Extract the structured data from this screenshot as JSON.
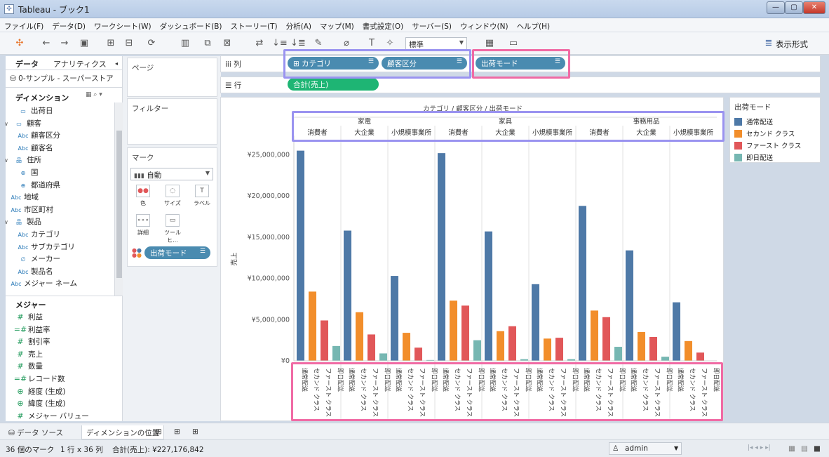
{
  "window": {
    "title": "Tableau - ブック1"
  },
  "menu": [
    "ファイル(F)",
    "データ(D)",
    "ワークシート(W)",
    "ダッシュボード(B)",
    "ストーリー(T)",
    "分析(A)",
    "マップ(M)",
    "書式設定(O)",
    "サーバー(S)",
    "ウィンドウ(N)",
    "ヘルプ(H)"
  ],
  "toolbar": {
    "fit_value": "標準",
    "show_me_label": "表示形式"
  },
  "left_pane": {
    "tab_data": "データ",
    "tab_analytics": "アナリティクス",
    "datasource": "0-サンプル - スーパーストア",
    "dimensions_header": "ディメンション",
    "dimensions": [
      {
        "icon": "calendar-icon",
        "glyph": "▭",
        "label": "出荷日",
        "indent": 2
      },
      {
        "icon": "folder-icon",
        "glyph": "▭",
        "label": "顧客",
        "indent": 1,
        "expand": "∨"
      },
      {
        "icon": "abc-icon",
        "glyph": "Abc",
        "label": "顧客区分",
        "indent": 2
      },
      {
        "icon": "abc-icon",
        "glyph": "Abc",
        "label": "顧客名",
        "indent": 2
      },
      {
        "icon": "hierarchy-icon",
        "glyph": "品",
        "label": "住所",
        "indent": 1,
        "expand": "∨"
      },
      {
        "icon": "globe-icon",
        "glyph": "⊕",
        "label": "国",
        "indent": 2
      },
      {
        "icon": "globe-icon",
        "glyph": "⊕",
        "label": "都道府県",
        "indent": 2
      },
      {
        "icon": "abc-icon",
        "glyph": "Abc",
        "label": "地域",
        "indent": 1
      },
      {
        "icon": "abc-icon",
        "glyph": "Abc",
        "label": "市区町村",
        "indent": 1
      },
      {
        "icon": "hierarchy-icon",
        "glyph": "品",
        "label": "製品",
        "indent": 1,
        "expand": "∨"
      },
      {
        "icon": "abc-icon",
        "glyph": "Abc",
        "label": "カテゴリ",
        "indent": 2
      },
      {
        "icon": "abc-icon",
        "glyph": "Abc",
        "label": "サブカテゴリ",
        "indent": 2
      },
      {
        "icon": "paperclip-icon",
        "glyph": "∅",
        "label": "メーカー",
        "indent": 2
      },
      {
        "icon": "abc-icon",
        "glyph": "Abc",
        "label": "製品名",
        "indent": 2
      },
      {
        "icon": "abc-icon",
        "glyph": "Abc",
        "label": "メジャー ネーム",
        "indent": 1
      }
    ],
    "measures_header": "メジャー",
    "measures": [
      {
        "glyph": "#",
        "label": "利益"
      },
      {
        "glyph": "=#",
        "label": "利益率"
      },
      {
        "glyph": "#",
        "label": "割引率"
      },
      {
        "glyph": "#",
        "label": "売上"
      },
      {
        "glyph": "#",
        "label": "数量"
      },
      {
        "glyph": "=#",
        "label": "レコード数"
      },
      {
        "glyph": "⊕",
        "label": "経度 (生成)"
      },
      {
        "glyph": "⊕",
        "label": "緯度 (生成)"
      },
      {
        "glyph": "#",
        "label": "メジャー バリュー"
      }
    ]
  },
  "cards": {
    "pages": "ページ",
    "filters": "フィルター",
    "marks": "マーク",
    "mark_type": "自動",
    "mark_buttons": [
      "色",
      "サイズ",
      "ラベル",
      "詳細",
      "ツールヒ..."
    ],
    "color_pill": "出荷モード"
  },
  "shelves": {
    "columns_label": "列",
    "rows_label": "行",
    "column_pills": [
      "カテゴリ",
      "顧客区分",
      "出荷モード"
    ],
    "row_pills": [
      "合計(売上)"
    ]
  },
  "chart_data": {
    "type": "bar",
    "title": "カテゴリ / 顧客区分 / 出荷モード",
    "ylabel": "売上",
    "ylim": [
      0,
      27000000
    ],
    "yticks": [
      "¥0",
      "¥5,000,000",
      "¥10,000,000",
      "¥15,000,000",
      "¥20,000,000",
      "¥25,000,000"
    ],
    "categories": [
      "家電",
      "家具",
      "事務用品"
    ],
    "segments": [
      "消費者",
      "大企業",
      "小規模事業所"
    ],
    "ship_modes": [
      "通常配送",
      "セカンド クラス",
      "ファースト クラス",
      "即日配送"
    ],
    "values": [
      [
        [
          25500000,
          8400000,
          4900000,
          1800000
        ],
        [
          15800000,
          5900000,
          3200000,
          900000
        ],
        [
          10300000,
          3400000,
          1600000,
          100000
        ]
      ],
      [
        [
          25200000,
          7300000,
          6700000,
          2500000
        ],
        [
          15700000,
          3600000,
          4200000,
          200000
        ],
        [
          9300000,
          2700000,
          2800000,
          200000
        ]
      ],
      [
        [
          18800000,
          6100000,
          5300000,
          1700000
        ],
        [
          13400000,
          3500000,
          2900000,
          500000
        ],
        [
          7100000,
          2400000,
          1000000,
          0
        ]
      ]
    ],
    "colors": [
      "#4e79a7",
      "#f28e2b",
      "#e15759",
      "#76b7b2"
    ]
  },
  "legend": {
    "title": "出荷モード"
  },
  "bottom_tabs": {
    "datasource_tab": "データ ソース",
    "sheet_tab": "ディメンションの位置"
  },
  "status": {
    "marks": "36 個のマーク",
    "rows_cols": "1 行 x 36 列",
    "sum": "合計(売上): ¥227,176,842",
    "user": "admin"
  },
  "highlights": {
    "blue": "#9a93f0",
    "pink": "#f06aa4"
  }
}
